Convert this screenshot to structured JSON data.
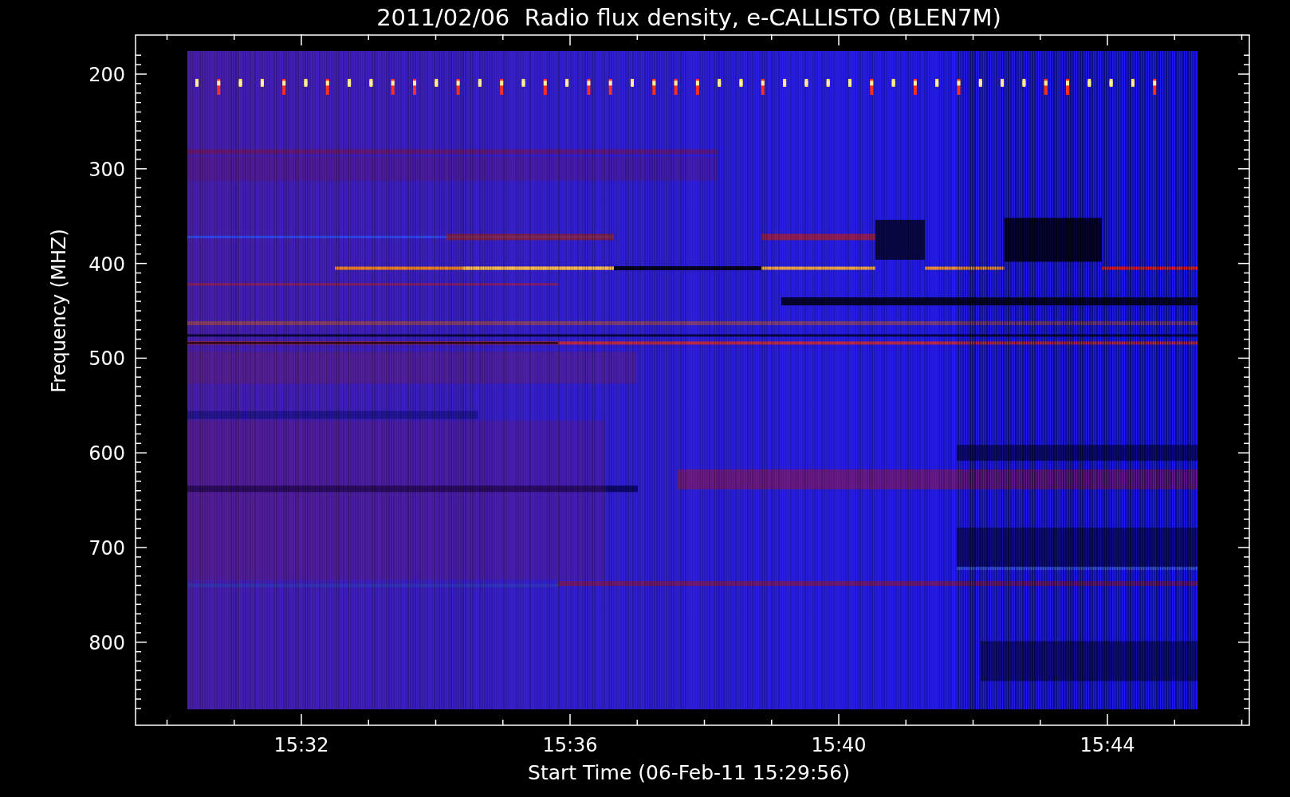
{
  "title": "2011/02/06  Radio flux density, e-CALLISTO (BLEN7M)",
  "plot": {
    "ylabel": "Frequency (MHZ)",
    "yticks": [
      "200",
      "300",
      "400",
      "500",
      "600",
      "700",
      "800"
    ],
    "xticks": [
      "15:32",
      "15:36",
      "15:40",
      "15:44"
    ],
    "xlabel": "Start Time (06-Feb-11 15:29:56)"
  }
}
